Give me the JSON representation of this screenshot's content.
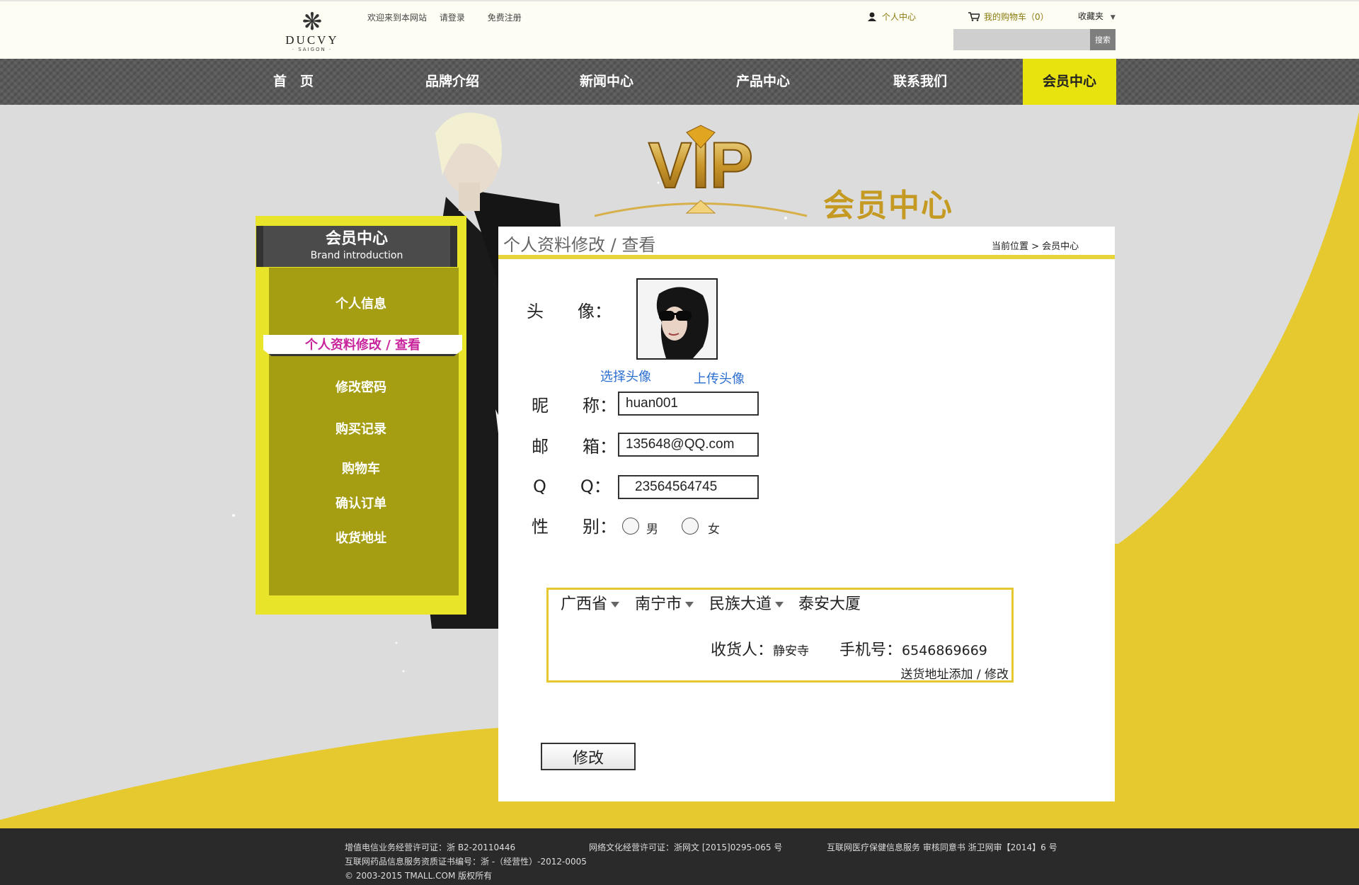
{
  "brand": {
    "name": "DUCVY",
    "sub": "· SAIGON ·"
  },
  "header": {
    "welcome": "欢迎来到本网站",
    "login": "请登录",
    "register": "免费注册",
    "user_center": "个人中心",
    "cart": "我的购物车（0）",
    "favorites": "收藏夹",
    "search_button": "搜索",
    "search_value": ""
  },
  "nav": [
    "首　页",
    "品牌介绍",
    "新闻中心",
    "产品中心",
    "联系我们",
    "会员中心"
  ],
  "hero": {
    "vip_text": "VIP",
    "title": "会员中心"
  },
  "sidebar": {
    "title": "会员中心",
    "subtitle": "Brand introduction",
    "items": [
      "个人信息",
      "个人资料修改 / 查看",
      "修改密码",
      "购买记录",
      "购物车",
      "确认订单",
      "收货地址"
    ]
  },
  "panel": {
    "title": "个人资料修改 / 查看",
    "breadcrumb": "当前位置 > 会员中心",
    "labels": {
      "avatar": "头　　像：",
      "nickname": "昵　　称：",
      "email": "邮　　箱：",
      "qq": "Q　　Q：",
      "gender": "性　　别："
    },
    "choose_avatar": "选择头像",
    "upload_avatar": "上传头像",
    "nickname_value": "huan001",
    "email_value": "135648@QQ.com",
    "qq_value": "23564564745",
    "gender_options": [
      "男",
      "女"
    ],
    "address": {
      "province": "广西省",
      "city": "南宁市",
      "road": "民族大道",
      "building": "泰安大厦",
      "receiver_label": "收货人：",
      "receiver": "静安寺",
      "phone_label": "手机号：",
      "phone": "6546869669",
      "edit_link": "送货地址添加 / 修改"
    },
    "submit": "修改"
  },
  "footer": {
    "license1": "增值电信业务经营许可证：浙 B2-20110446",
    "license2": "网络文化经营许可证：浙网文 [2015]0295-065 号",
    "license3": "互联网医疗保健信息服务 审核同意书 浙卫网审【2014】6 号",
    "license4": "互联网药品信息服务资质证书编号：浙 -（经营性）-2012-0005",
    "copyright": "© 2003-2015 TMALL.COM 版权所有"
  },
  "colors": {
    "accent": "#e8e20f",
    "nav": "#5a5a5a",
    "gold": "#c49a22",
    "link": "#2a6ed0",
    "active_side": "#c8249c"
  }
}
